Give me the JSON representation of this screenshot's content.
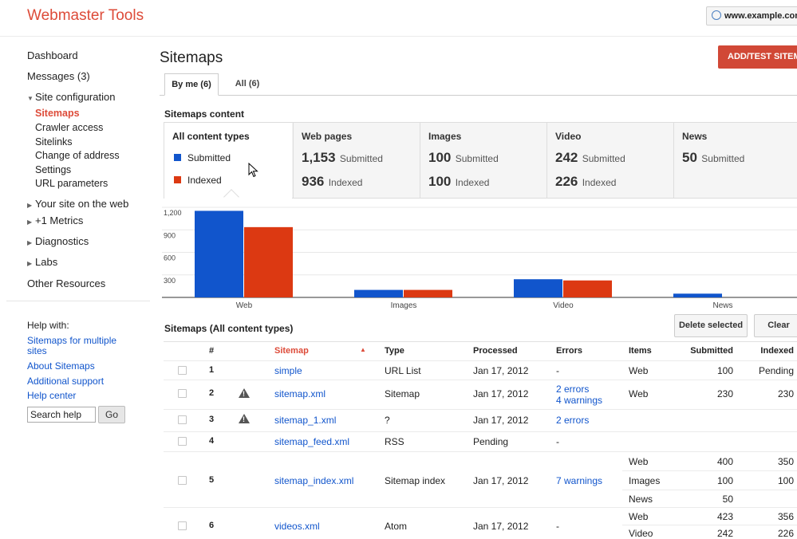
{
  "header": {
    "brand": "Webmaster Tools",
    "site": "www.example.com"
  },
  "sidebar": {
    "dashboard": "Dashboard",
    "messages": "Messages (3)",
    "site_configuration": "Site configuration",
    "sub_items": [
      "Sitemaps",
      "Crawler access",
      "Sitelinks",
      "Change of address",
      "Settings",
      "URL parameters"
    ],
    "your_site": "Your site on the web",
    "plus1": "+1 Metrics",
    "diagnostics": "Diagnostics",
    "labs": "Labs",
    "other": "Other Resources",
    "help_heading": "Help with:",
    "help_links": [
      "Sitemaps for multiple",
      "sites",
      "About Sitemaps",
      "Additional support",
      "Help center"
    ],
    "search_value": "Search help",
    "go": "Go"
  },
  "main": {
    "title": "Sitemaps",
    "add_button": "ADD/TEST SITEMAP",
    "tabs": [
      "By me (6)",
      "All (6)"
    ],
    "content_title": "Sitemaps content",
    "list_title": "Sitemaps (All content types)",
    "delete_button": "Delete selected",
    "clear_button": "Clear"
  },
  "content_types": {
    "all": {
      "label": "All content types",
      "submitted": "Submitted",
      "indexed": "Indexed"
    },
    "web": {
      "label": "Web pages",
      "submitted": "1,153",
      "indexed": "936"
    },
    "images": {
      "label": "Images",
      "submitted": "100",
      "indexed": "100"
    },
    "video": {
      "label": "Video",
      "submitted": "242",
      "indexed": "226"
    },
    "news": {
      "label": "News",
      "submitted": "50"
    },
    "submitted_word": "Submitted",
    "indexed_word": "Indexed"
  },
  "colors": {
    "submitted": "#1155cc",
    "indexed": "#dc3912",
    "brand": "#dd4b39"
  },
  "chart_data": {
    "type": "bar",
    "categories": [
      "Web",
      "Images",
      "Video",
      "News"
    ],
    "series": [
      {
        "name": "Submitted",
        "values": [
          1153,
          100,
          242,
          50
        ]
      },
      {
        "name": "Indexed",
        "values": [
          936,
          100,
          226,
          0
        ]
      }
    ],
    "yticks": [
      "300",
      "600",
      "900",
      "1,200"
    ],
    "ylim": [
      0,
      1200
    ],
    "grid": true
  },
  "table": {
    "headers": [
      "#",
      "Sitemap",
      "Type",
      "Processed",
      "Errors",
      "Items",
      "Submitted",
      "Indexed"
    ],
    "rows": [
      {
        "n": "1",
        "sitemap": "simple",
        "type": "URL List",
        "processed": "Jan 17, 2012",
        "errors": "-",
        "items": [
          [
            "Web",
            "100",
            "Pending"
          ]
        ]
      },
      {
        "n": "2",
        "sitemap": "sitemap.xml",
        "type": "Sitemap",
        "processed": "Jan 17, 2012",
        "errors": "2 errors",
        "errors2": "4 warnings",
        "items": [
          [
            "Web",
            "230",
            "230"
          ]
        ]
      },
      {
        "n": "3",
        "sitemap": "sitemap_1.xml",
        "type": "?",
        "processed": "Jan 17, 2012",
        "errors": "2 errors",
        "items": []
      },
      {
        "n": "4",
        "sitemap": "sitemap_feed.xml",
        "type": "RSS",
        "processed": "Pending",
        "errors": "-",
        "items": []
      },
      {
        "n": "5",
        "sitemap": "sitemap_index.xml",
        "type": "Sitemap index",
        "processed": "Jan 17, 2012",
        "errors": "7 warnings",
        "items": [
          [
            "Web",
            "400",
            "350"
          ],
          [
            "Images",
            "100",
            "100"
          ],
          [
            "News",
            "50",
            ""
          ]
        ]
      },
      {
        "n": "6",
        "sitemap": "videos.xml",
        "type": "Atom",
        "processed": "Jan 17, 2012",
        "errors": "-",
        "items": [
          [
            "Web",
            "423",
            "356"
          ],
          [
            "Video",
            "242",
            "226"
          ]
        ]
      }
    ]
  }
}
